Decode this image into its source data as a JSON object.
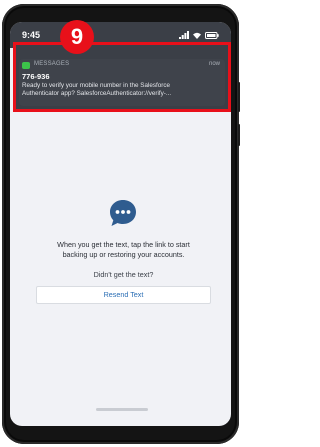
{
  "step_badge": "9",
  "status_bar": {
    "time": "9:45"
  },
  "notification": {
    "app_name": "MESSAGES",
    "when": "now",
    "sender": "776-936",
    "body_line1": "Ready to verify your mobile number in the Salesforce",
    "body_line2": "Authenticator app? SalesforceAuthenticator://verify-..."
  },
  "main": {
    "line1": "When you get the text, tap the link to start",
    "line2": "backing up or restoring your accounts.",
    "didnt_get": "Didn't get the text?",
    "resend_label": "Resend Text"
  },
  "colors": {
    "highlight_red": "#e8101a",
    "link_blue": "#2c6fb5",
    "chat_icon_blue": "#2f5c8f",
    "screen_bg": "#f1f2f6"
  },
  "icons": [
    "signal-icon",
    "wifi-icon",
    "battery-icon",
    "messages-app-icon",
    "chat-bubble-icon"
  ]
}
